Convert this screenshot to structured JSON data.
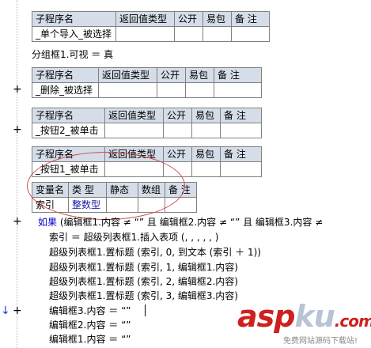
{
  "tables": {
    "t1": {
      "headers": [
        "子程序名",
        "返回值类型",
        "公开",
        "易包",
        "备 注"
      ],
      "row": [
        "_单个导入_被选择",
        "",
        "",
        "",
        ""
      ]
    },
    "t2": {
      "headers": [
        "子程序名",
        "返回值类型",
        "公开",
        "易包",
        "备 注"
      ],
      "row": [
        "_删除_被选择",
        "",
        "",
        "",
        ""
      ]
    },
    "t3": {
      "headers": [
        "子程序名",
        "返回值类型",
        "公开",
        "易包",
        "备 注"
      ],
      "row": [
        "_按钮2_被单击",
        "",
        "",
        "",
        ""
      ]
    },
    "t4": {
      "headers": [
        "子程序名",
        "返回值类型",
        "公开",
        "易包",
        "备 注"
      ],
      "row": [
        "_按钮1_被单击",
        "",
        "",
        "",
        ""
      ]
    },
    "vars": {
      "headers": [
        "变量名",
        "类 型",
        "静态",
        "数组",
        "备 注"
      ],
      "row": [
        "索引",
        "整数型",
        "",
        "",
        ""
      ]
    }
  },
  "code": {
    "group_line": "分组框1.可视 ＝ 真",
    "if_kw": "如果",
    "if_rest": "(编辑框1.内容 ≠ “” 且 编辑框2.内容 ≠ “” 且 编辑框3.内容 ≠",
    "line_insert": "索引 ＝ 超级列表框1.插入表项 (, , , , , )",
    "line_title0": "超级列表框1.置标题 (索引, 0, 到文本 (索引 ＋ 1))",
    "line_title1": "超级列表框1.置标题 (索引, 1, 编辑框1.内容)",
    "line_title2": "超级列表框1.置标题 (索引, 2, 编辑框2.内容)",
    "line_title3": "超级列表框1.置标题 (索引, 3, 编辑框3.内容)",
    "line_clear3": "编辑框3.内容 ＝ “”",
    "line_clear2": "编辑框2.内容 ＝ “”",
    "line_clear1": "编辑框1.内容 ＝ “”"
  },
  "gutter": {
    "plus": "+",
    "arrow": "↓"
  },
  "watermark": {
    "asp": "asp",
    "ku": "ku",
    "com": ".com",
    "sub": "免费网站源码下载站!"
  },
  "colors": {
    "header_bg": "#d4dde8",
    "border": "#808080",
    "keyword": "#0000cc",
    "annotation": "#d14a4a"
  }
}
